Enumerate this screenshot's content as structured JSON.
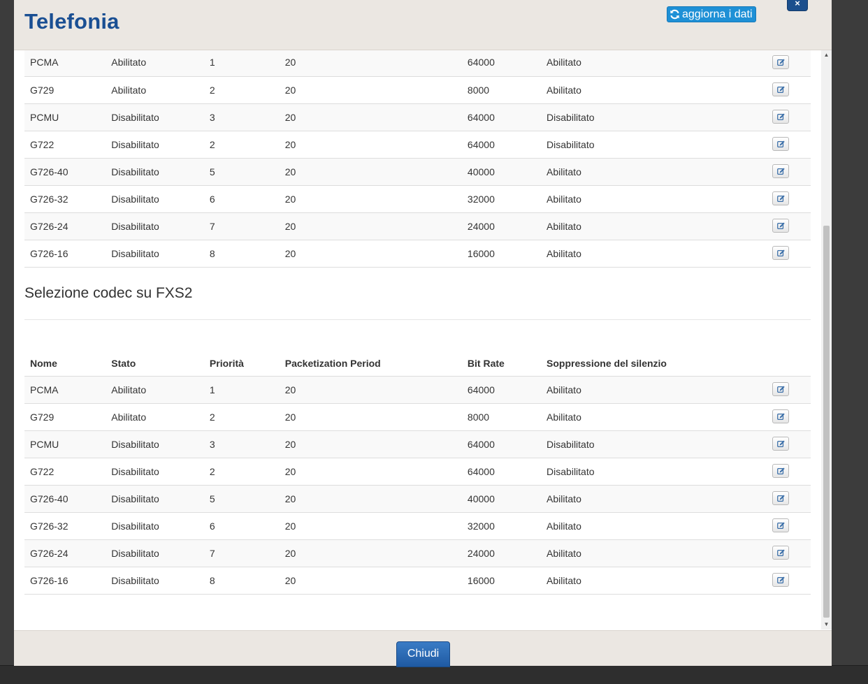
{
  "modal": {
    "title": "Telefonia",
    "refresh_label": "aggiorna i dati",
    "close_x": "×",
    "footer_close_label": "Chiudi"
  },
  "section_fxs2": {
    "title": "Selezione codec su FXS2"
  },
  "columns": [
    "Nome",
    "Stato",
    "Priorità",
    "Packetization Period",
    "Bit Rate",
    "Soppressione del silenzio"
  ],
  "table_fxs1": [
    [
      "PCMA",
      "Abilitato",
      "1",
      "20",
      "64000",
      "Abilitato"
    ],
    [
      "G729",
      "Abilitato",
      "2",
      "20",
      "8000",
      "Abilitato"
    ],
    [
      "PCMU",
      "Disabilitato",
      "3",
      "20",
      "64000",
      "Disabilitato"
    ],
    [
      "G722",
      "Disabilitato",
      "2",
      "20",
      "64000",
      "Disabilitato"
    ],
    [
      "G726-40",
      "Disabilitato",
      "5",
      "20",
      "40000",
      "Abilitato"
    ],
    [
      "G726-32",
      "Disabilitato",
      "6",
      "20",
      "32000",
      "Abilitato"
    ],
    [
      "G726-24",
      "Disabilitato",
      "7",
      "20",
      "24000",
      "Abilitato"
    ],
    [
      "G726-16",
      "Disabilitato",
      "8",
      "20",
      "16000",
      "Abilitato"
    ]
  ],
  "table_fxs2": [
    [
      "PCMA",
      "Abilitato",
      "1",
      "20",
      "64000",
      "Abilitato"
    ],
    [
      "G729",
      "Abilitato",
      "2",
      "20",
      "8000",
      "Abilitato"
    ],
    [
      "PCMU",
      "Disabilitato",
      "3",
      "20",
      "64000",
      "Disabilitato"
    ],
    [
      "G722",
      "Disabilitato",
      "2",
      "20",
      "64000",
      "Disabilitato"
    ],
    [
      "G726-40",
      "Disabilitato",
      "5",
      "20",
      "40000",
      "Abilitato"
    ],
    [
      "G726-32",
      "Disabilitato",
      "6",
      "20",
      "32000",
      "Abilitato"
    ],
    [
      "G726-24",
      "Disabilitato",
      "7",
      "20",
      "24000",
      "Abilitato"
    ],
    [
      "G726-16",
      "Disabilitato",
      "8",
      "20",
      "16000",
      "Abilitato"
    ]
  ],
  "icons": {
    "refresh": "refresh-icon",
    "edit": "edit-icon",
    "close": "close-icon"
  },
  "colors": {
    "title": "#1a4f93",
    "refresh_button": "#1e90d6",
    "primary_button": "#1f5aa3"
  }
}
